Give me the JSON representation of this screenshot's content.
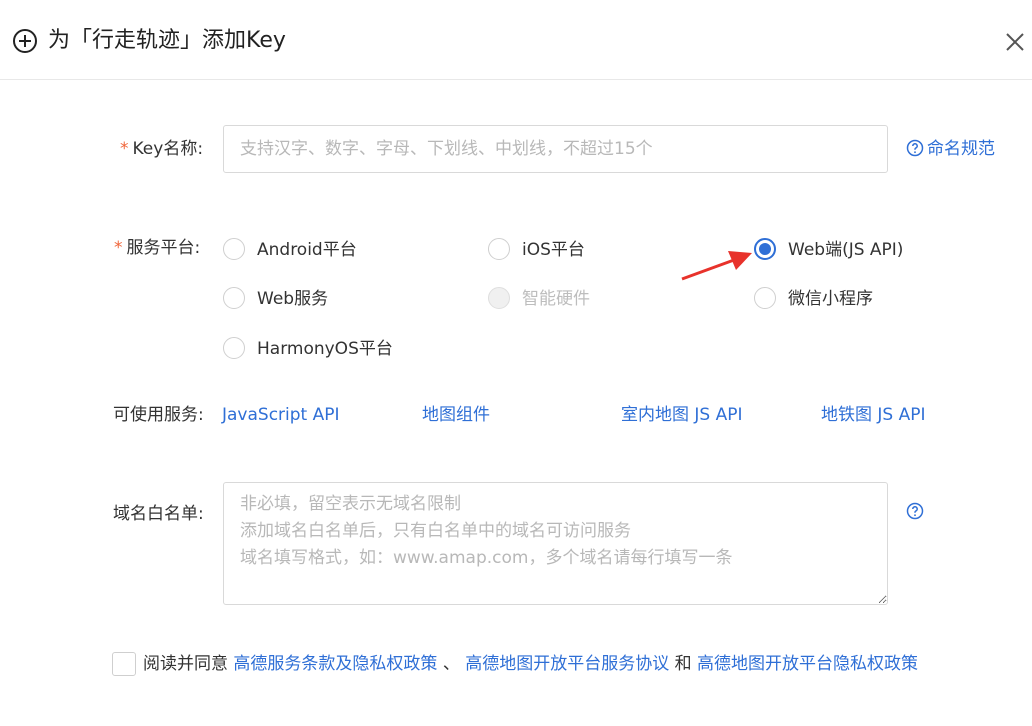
{
  "header": {
    "title": "为「行走轨迹」添加Key"
  },
  "form": {
    "key_name": {
      "required_mark": "*",
      "label": "Key名称:",
      "placeholder": "支持汉字、数字、字母、下划线、中划线，不超过15个",
      "value": "",
      "help_link": "命名规范"
    },
    "platform": {
      "required_mark": "*",
      "label": "服务平台:",
      "selected": "Web端(JS API)",
      "options": [
        {
          "label": "Android平台",
          "checked": false,
          "disabled": false
        },
        {
          "label": "iOS平台",
          "checked": false,
          "disabled": false
        },
        {
          "label": "Web端(JS API)",
          "checked": true,
          "disabled": false
        },
        {
          "label": "Web服务",
          "checked": false,
          "disabled": false
        },
        {
          "label": "智能硬件",
          "checked": false,
          "disabled": true
        },
        {
          "label": "微信小程序",
          "checked": false,
          "disabled": false
        },
        {
          "label": "HarmonyOS平台",
          "checked": false,
          "disabled": false
        }
      ]
    },
    "services": {
      "label": "可使用服务:",
      "links": [
        "JavaScript API",
        "地图组件",
        "室内地图 JS API",
        "地铁图 JS API"
      ]
    },
    "whitelist": {
      "label": "域名白名单:",
      "placeholder": "非必填，留空表示无域名限制\n添加域名白名单后，只有白名单中的域名可访问服务\n域名填写格式，如：www.amap.com，多个域名请每行填写一条",
      "value": ""
    },
    "agreement": {
      "checked": false,
      "prefix": "阅读并同意",
      "link1": "高德服务条款及隐私权政策",
      "sep": "、",
      "link2": "高德地图开放平台服务协议",
      "and": "和",
      "link3": "高德地图开放平台隐私权政策"
    }
  },
  "colors": {
    "accent": "#2f6fd6",
    "required": "#f0653a",
    "arrow": "#e8322b"
  },
  "icons": [
    "add-circle-icon",
    "close-icon",
    "question-circle-icon",
    "red-arrow-pointer"
  ]
}
